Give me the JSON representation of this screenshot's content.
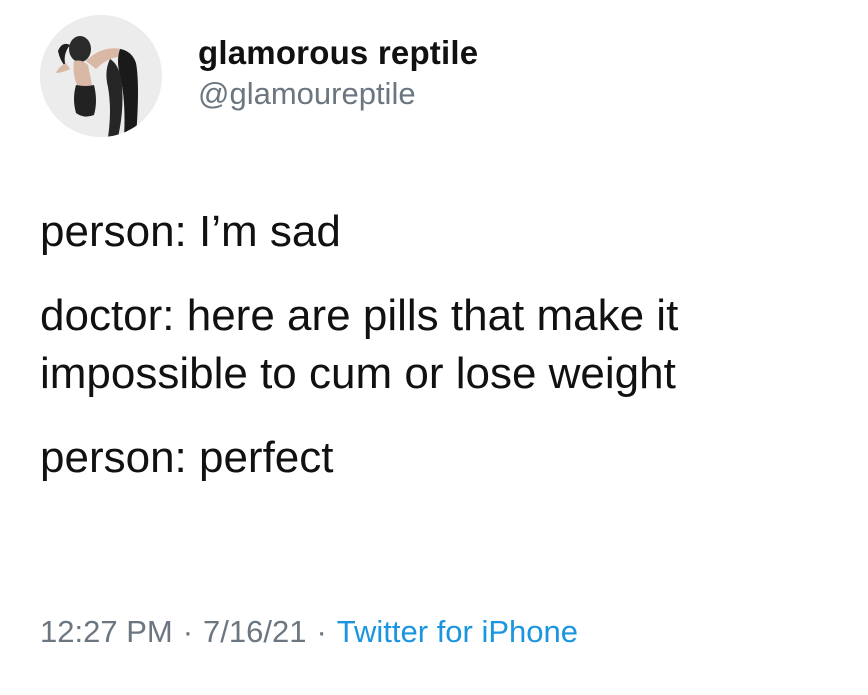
{
  "user": {
    "display_name": "glamorous reptile",
    "handle": "@glamoureptile",
    "avatar_icon": "profile-photo"
  },
  "tweet": {
    "lines": [
      "person: I’m sad",
      "doctor: here are pills that make it impossible to cum or lose weight",
      "person: perfect"
    ]
  },
  "meta": {
    "time": "12:27 PM",
    "separator": "·",
    "date": "7/16/21",
    "source": "Twitter for iPhone"
  },
  "colors": {
    "text": "#111111",
    "secondary": "#6b7680",
    "link": "#1b95e0"
  }
}
